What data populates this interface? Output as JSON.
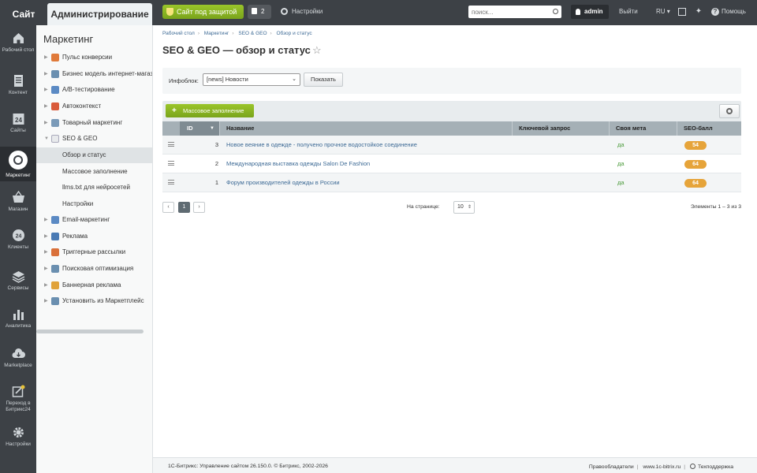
{
  "topbar": {
    "tab_site": "Сайт",
    "tab_admin": "Администрирование",
    "protect_label": "Сайт под защитой",
    "notify_count": "2",
    "settings_label": "Настройки",
    "search_placeholder": "поиск...",
    "user": "admin",
    "logout": "Выйти",
    "lang": "RU",
    "help": "Помощь"
  },
  "rail": [
    {
      "label": "Рабочий стол",
      "icon": "home-icon"
    },
    {
      "label": "Контент",
      "icon": "document-icon"
    },
    {
      "label": "Сайты",
      "icon": "calendar-icon"
    },
    {
      "label": "Маркетинг",
      "icon": "target-icon"
    },
    {
      "label": "Магазин",
      "icon": "basket-icon"
    },
    {
      "label": "Клиенты",
      "icon": "clients-icon"
    },
    {
      "label": "Сервисы",
      "icon": "layers-icon"
    },
    {
      "label": "Аналитика",
      "icon": "chart-icon"
    },
    {
      "label": "Marketplace",
      "icon": "cloud-icon"
    },
    {
      "label": "Переход в Битрикс24",
      "icon": "bitrix24-icon"
    },
    {
      "label": "Настройки",
      "icon": "gear-icon"
    }
  ],
  "calendar_day": "24",
  "clients_num": "24",
  "menu": {
    "title": "Маркетинг",
    "items": [
      {
        "label": "Пульс конверсии"
      },
      {
        "label": "Бизнес модель интернет-магазин"
      },
      {
        "label": "A/B-тестирование"
      },
      {
        "label": "Автоконтекст"
      },
      {
        "label": "Товарный маркетинг"
      },
      {
        "label": "SEO & GEO"
      },
      {
        "label": "Обзор и статус"
      },
      {
        "label": "Массовое заполнение"
      },
      {
        "label": "llms.txt для нейросетей"
      },
      {
        "label": "Настройки"
      },
      {
        "label": "Email-маркетинг"
      },
      {
        "label": "Реклама"
      },
      {
        "label": "Триггерные рассылки"
      },
      {
        "label": "Поисковая оптимизация"
      },
      {
        "label": "Баннерная реклама"
      },
      {
        "label": "Установить из Маркетплейс"
      }
    ]
  },
  "breadcrumbs": [
    "Рабочий стол",
    "Маркетинг",
    "SEO & GEO",
    "Обзор и статус"
  ],
  "page_title": "SEO & GEO — обзор и статус",
  "filter": {
    "label": "Инфоблок:",
    "selected": "[news] Новости",
    "button": "Показать"
  },
  "grid": {
    "mass_button": "Массовое заполнение",
    "columns": [
      "ID",
      "Название",
      "Ключевой запрос",
      "Своя мета",
      "SEO-балл"
    ],
    "rows": [
      {
        "id": "3",
        "name": "Новое веяние в одежде - получено прочное водостойкое соединение",
        "meta": "да",
        "score": "54"
      },
      {
        "id": "2",
        "name": "Международная выставка одежды Salon De Fashion",
        "meta": "да",
        "score": "64"
      },
      {
        "id": "1",
        "name": "Форум производителей одежды в России",
        "meta": "да",
        "score": "64"
      }
    ]
  },
  "pager": {
    "prev": "‹",
    "current": "1",
    "next": "›",
    "perpage_label": "На странице:",
    "perpage_value": "10",
    "elements": "Элементы 1 – 3 из 3"
  },
  "footer": {
    "copyright": "1С-Битрикс: Управление сайтом 26.150.0. © Битрикс, 2002-2026",
    "owners": "Правообладатели",
    "site": "www.1c-bitrix.ru",
    "support": "Техподдержка"
  },
  "colors": {
    "accent_green": "#8bb522",
    "score_orange": "#e6a43a",
    "link_blue": "#3d6a95",
    "dark_bar": "#3d4146"
  }
}
